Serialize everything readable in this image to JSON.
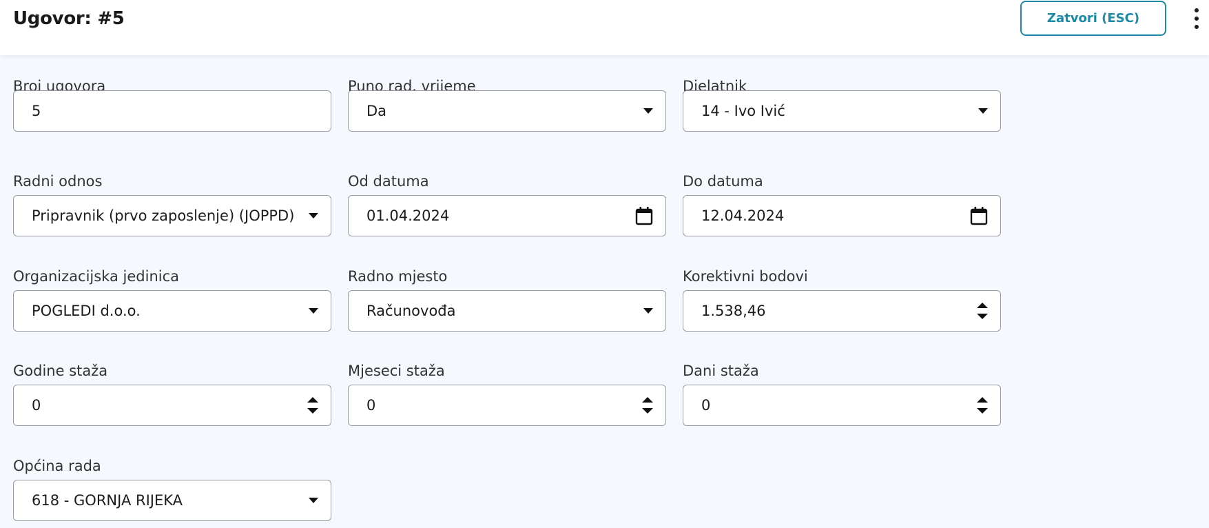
{
  "header": {
    "title": "Ugovor: #5",
    "close_label": "Zatvori (ESC)"
  },
  "form": {
    "broj_ugovora": {
      "label": "Broj ugovora",
      "value": "5"
    },
    "puno_radno_vrijeme": {
      "label": "Puno rad. vrijeme",
      "value": "Da"
    },
    "djelatnik": {
      "label": "Djelatnik",
      "value": "14 - Ivo Ivić"
    },
    "radni_odnos": {
      "label": "Radni odnos",
      "value": "Pripravnik (prvo zaposlenje) (JOPPD)"
    },
    "od_datuma": {
      "label": "Od datuma",
      "value": "01.04.2024"
    },
    "do_datuma": {
      "label": "Do datuma",
      "value": "12.04.2024"
    },
    "organizacijska_jedinica": {
      "label": "Organizacijska jedinica",
      "value": "POGLEDI d.o.o."
    },
    "radno_mjesto": {
      "label": "Radno mjesto",
      "value": "Računovođa"
    },
    "korektivni_bodovi": {
      "label": "Korektivni bodovi",
      "value": "1.538,46"
    },
    "godine_staza": {
      "label": "Godine staža",
      "value": "0"
    },
    "mjeseci_staza": {
      "label": "Mjeseci staža",
      "value": "0"
    },
    "dani_staza": {
      "label": "Dani staža",
      "value": "0"
    },
    "opcina_rada": {
      "label": "Općina rada",
      "value": "618 - GORNJA RIJEKA"
    }
  },
  "colors": {
    "accent": "#1a8aa7",
    "background": "#f5f8fd",
    "border": "#9a9aa2"
  },
  "icons": {
    "select": "chevron-down-icon",
    "number": "spinner-icon",
    "date": "calendar-icon",
    "menu": "more-vertical-icon"
  }
}
